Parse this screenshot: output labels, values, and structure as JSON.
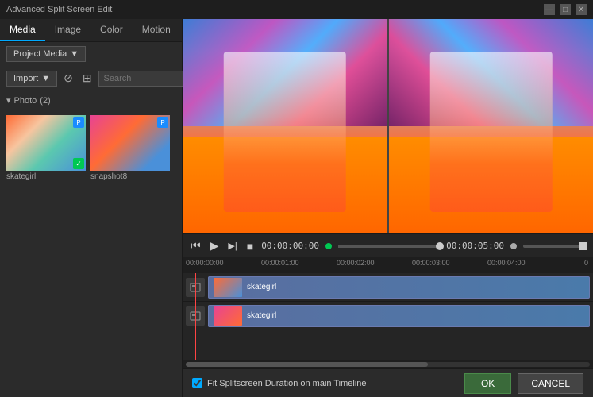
{
  "window": {
    "title": "Advanced Split Screen Edit",
    "controls": [
      "minimize",
      "maximize",
      "close"
    ]
  },
  "tabs": {
    "items": [
      {
        "label": "Media",
        "active": true
      },
      {
        "label": "Image",
        "active": false
      },
      {
        "label": "Color",
        "active": false
      },
      {
        "label": "Motion",
        "active": false
      }
    ]
  },
  "toolbar": {
    "dropdown_label": "Project Media",
    "dropdown_arrow": "▼",
    "import_label": "Import",
    "search_placeholder": "Search"
  },
  "media": {
    "section_label": "Photo",
    "count": "(2)",
    "items": [
      {
        "name": "skategirl",
        "has_badge": true,
        "has_check": true
      },
      {
        "name": "snapshot8",
        "has_badge": true,
        "has_check": false
      }
    ]
  },
  "playback": {
    "time_current": "00:00:00:00",
    "time_total": "00:00:05:00",
    "play_icon": "▶",
    "pause_icon": "⏸",
    "rewind_icon": "⏮",
    "stop_icon": "⏹"
  },
  "timeline": {
    "ruler_marks": [
      "00:00:00:00",
      "00:00:01:00",
      "00:00:02:00",
      "00:00:03:00",
      "00:00:04:00",
      "0"
    ],
    "tracks": [
      {
        "clip_name": "skategirl",
        "icon": "🎬"
      },
      {
        "clip_name": "skategirl",
        "icon": "🎬"
      }
    ]
  },
  "footer": {
    "checkbox_label": "Fit Splitscreen Duration on main Timeline",
    "checkbox_checked": true,
    "ok_label": "OK",
    "cancel_label": "CANCEL"
  }
}
